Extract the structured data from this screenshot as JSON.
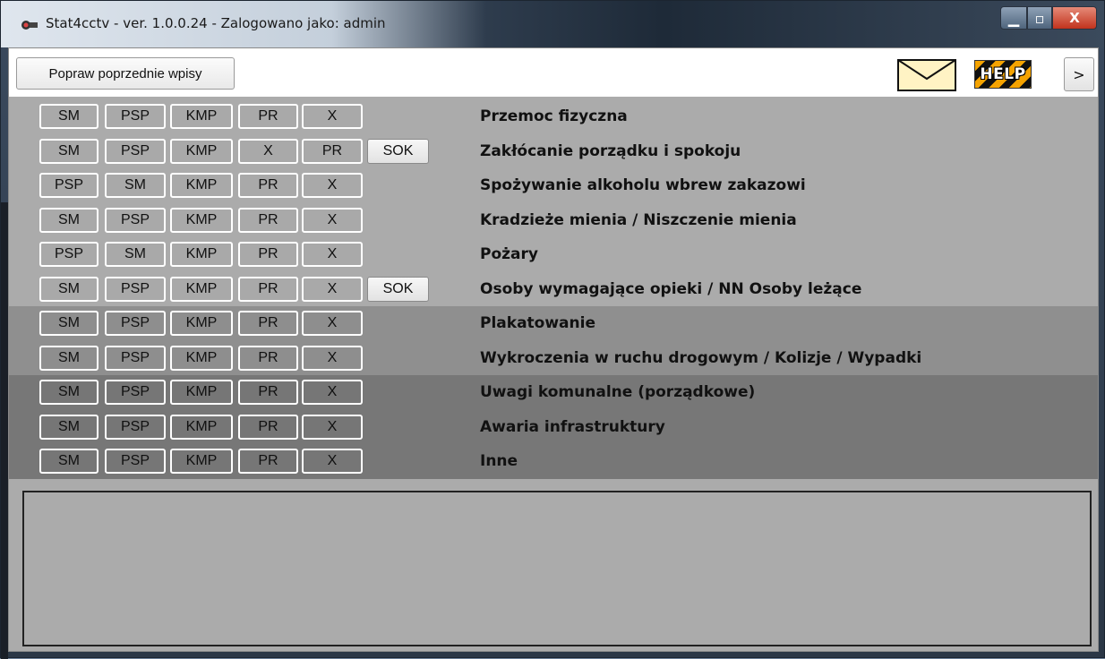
{
  "window": {
    "title": "Stat4cctv - ver. 1.0.0.24 - Zalogowano jako: admin",
    "controls": {
      "minimize": "▁",
      "maximize": "▫",
      "close": "X"
    }
  },
  "toolbar": {
    "prev_entries_label": "Popraw poprzednie wpisy",
    "help_label": "HELP",
    "next_label": ">"
  },
  "categories": [
    {
      "label": "Przemoc fizyczna",
      "buttons": [
        "SM",
        "PSP",
        "KMP",
        "PR",
        "X",
        ""
      ]
    },
    {
      "label": "Zakłócanie porządku i spokoju",
      "buttons": [
        "SM",
        "PSP",
        "KMP",
        "X",
        "PR",
        "SOK"
      ]
    },
    {
      "label": "Spożywanie alkoholu wbrew zakazowi",
      "buttons": [
        "PSP",
        "SM",
        "KMP",
        "PR",
        "X",
        ""
      ]
    },
    {
      "label": "Kradzieże mienia / Niszczenie mienia",
      "buttons": [
        "SM",
        "PSP",
        "KMP",
        "PR",
        "X",
        ""
      ]
    },
    {
      "label": "Pożary",
      "buttons": [
        "PSP",
        "SM",
        "KMP",
        "PR",
        "X",
        ""
      ]
    },
    {
      "label": "Osoby wymagające opieki / NN Osoby leżące",
      "buttons": [
        "SM",
        "PSP",
        "KMP",
        "PR",
        "X",
        "SOK"
      ]
    },
    {
      "label": "Plakatowanie",
      "buttons": [
        "SM",
        "PSP",
        "KMP",
        "PR",
        "X",
        ""
      ]
    },
    {
      "label": "Wykroczenia w ruchu drogowym / Kolizje / Wypadki",
      "buttons": [
        "SM",
        "PSP",
        "KMP",
        "PR",
        "X",
        ""
      ]
    },
    {
      "label": "Uwagi komunalne (porządkowe)",
      "buttons": [
        "SM",
        "PSP",
        "KMP",
        "PR",
        "X",
        ""
      ]
    },
    {
      "label": "Awaria infrastruktury",
      "buttons": [
        "SM",
        "PSP",
        "KMP",
        "PR",
        "X",
        ""
      ]
    },
    {
      "label": "Inne",
      "buttons": [
        "SM",
        "PSP",
        "KMP",
        "PR",
        "X",
        ""
      ]
    }
  ],
  "colors": {
    "group1": "#ababab",
    "group2": "#8f8f8f",
    "group3": "#777777"
  },
  "icons": {
    "app": "camera-icon",
    "mail": "mail-icon",
    "help": "help-icon"
  }
}
